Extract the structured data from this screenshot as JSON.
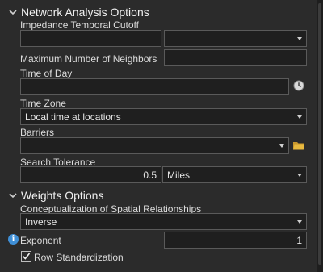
{
  "network_section": {
    "title": "Network Analysis Options",
    "impedance_cutoff_label": "Impedance Temporal Cutoff",
    "impedance_cutoff_value": "",
    "impedance_unit_value": "",
    "max_neighbors_label": "Maximum Number of Neighbors",
    "max_neighbors_value": "",
    "time_of_day_label": "Time of Day",
    "time_of_day_value": "",
    "time_zone_label": "Time Zone",
    "time_zone_value": "Local time at locations",
    "barriers_label": "Barriers",
    "barriers_value": "",
    "search_tolerance_label": "Search Tolerance",
    "search_tolerance_value": "0.5",
    "search_tolerance_unit": "Miles"
  },
  "weights_section": {
    "title": "Weights Options",
    "conceptualization_label": "Conceptualization of Spatial Relationships",
    "conceptualization_value": "Inverse",
    "exponent_label": "Exponent",
    "exponent_value": "1",
    "row_standardization_label": "Row Standardization",
    "row_standardization_checked": true
  },
  "icons": {
    "section_toggle": "chevron-down-icon",
    "time_picker": "clock-icon",
    "browse": "folder-icon",
    "info": "info-icon",
    "dropdown": "caret-down-icon"
  },
  "colors": {
    "info_blue": "#3f8fd6",
    "folder_yellow": "#e8b93f"
  }
}
